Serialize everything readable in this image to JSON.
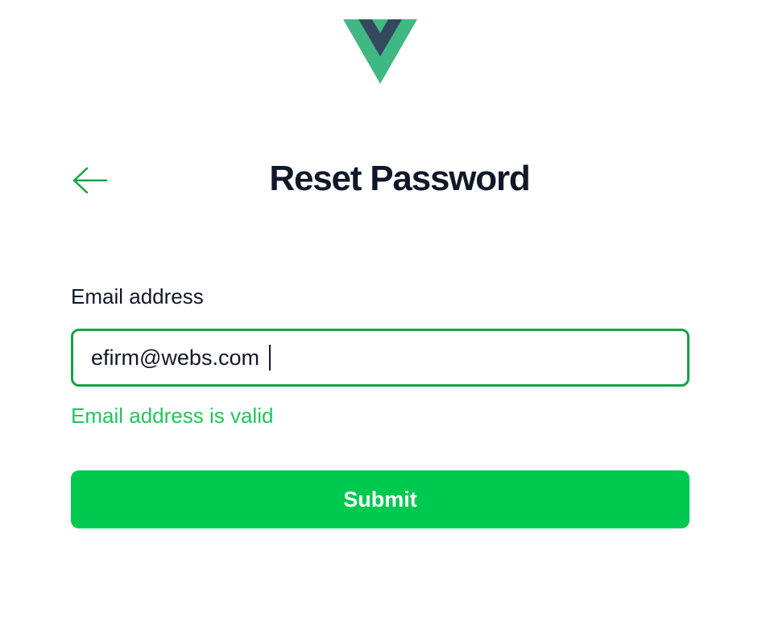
{
  "page": {
    "title": "Reset Password"
  },
  "icons": {
    "logo": "vue-logo",
    "back": "arrow-left-icon"
  },
  "form": {
    "email_label": "Email address",
    "email_value": "efirm@webs.com",
    "validation_message": "Email address is valid",
    "submit_label": "Submit"
  },
  "colors": {
    "logo_outer": "#41b883",
    "logo_inner": "#35495e",
    "accent": "#16a34a",
    "valid_text": "#22c55e",
    "button_bg": "#00c94f",
    "title_text": "#101828"
  }
}
